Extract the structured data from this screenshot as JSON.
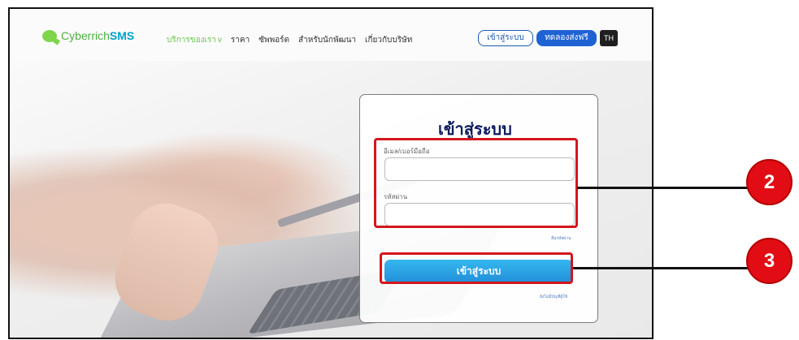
{
  "brand": {
    "name_light": "Cyberrich",
    "name_bold": "SMS"
  },
  "nav": {
    "items": [
      {
        "label": "บริการของเรา",
        "active": true,
        "chevron": "v"
      },
      {
        "label": "ราคา"
      },
      {
        "label": "ซัพพอร์ต"
      },
      {
        "label": "สำหรับนักพัฒนา"
      },
      {
        "label": "เกี่ยวกับบริษัท"
      }
    ],
    "login_label": "เข้าสู่ระบบ",
    "trial_label": "ทดลองส่งฟรี",
    "lang_label": "TH"
  },
  "login_card": {
    "title": "เข้าสู่ระบบ",
    "email_label": "อีเมล/เบอร์มือถือ",
    "email_value": "",
    "password_label": "รหัสผ่าน",
    "password_value": "",
    "forgot_label": "ลืมรหัสผ่าน",
    "submit_label": "เข้าสู่ระบบ",
    "register_label": "ยังไม่มีบัญชีผู้ใช้"
  },
  "annotations": {
    "marker_2": "2",
    "marker_3": "3"
  },
  "colors": {
    "accent_blue": "#1f63d2",
    "highlight_red": "#d3161d",
    "marker_red": "#e20d14"
  }
}
